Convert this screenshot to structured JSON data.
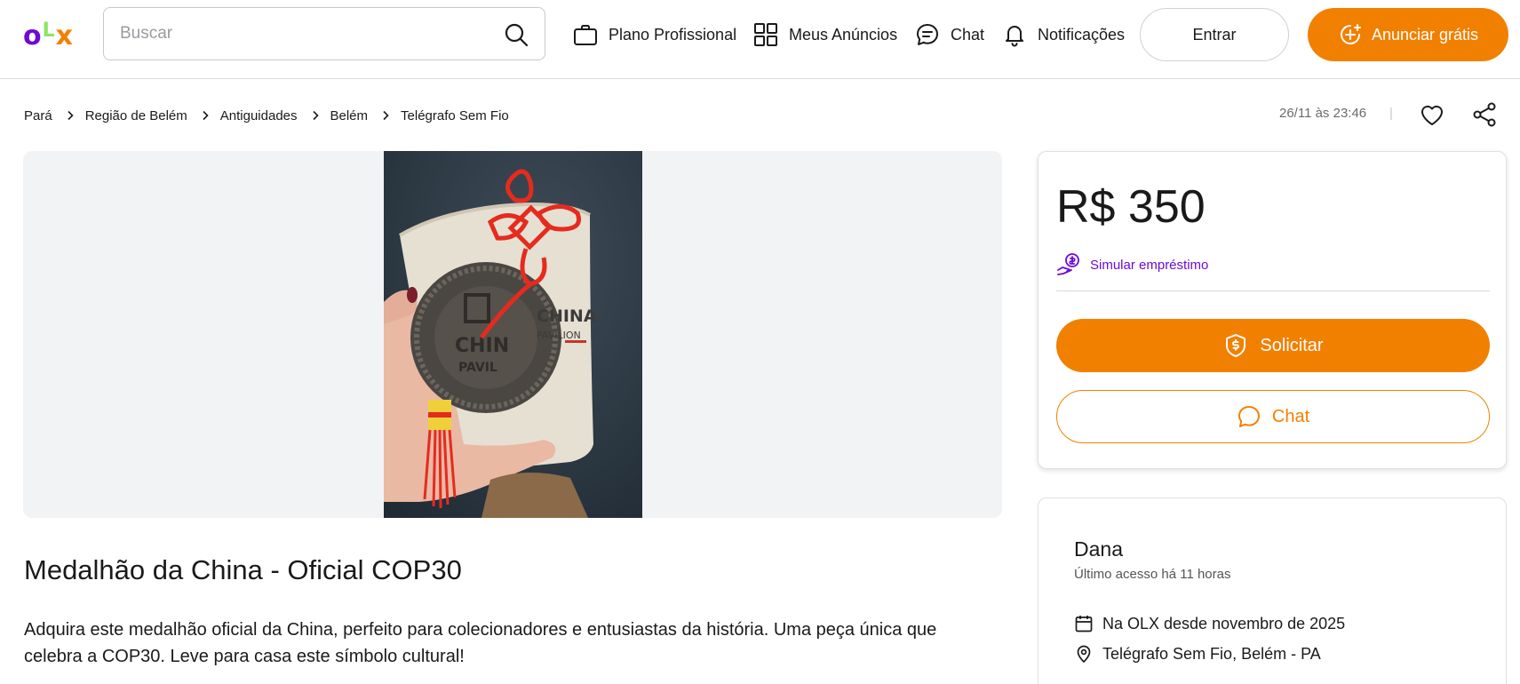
{
  "header": {
    "logo": {
      "o": "o",
      "l": "L",
      "x": "x"
    },
    "search": {
      "placeholder": "Buscar",
      "value": ""
    },
    "nav": {
      "plano": "Plano Profissional",
      "anuncios": "Meus Anúncios",
      "chat": "Chat",
      "notificacoes": "Notificações"
    },
    "entrar": "Entrar",
    "anunciar": "Anunciar grátis"
  },
  "breadcrumb": [
    "Pará",
    "Região de Belém",
    "Antiguidades",
    "Belém",
    "Telégrafo Sem Fio"
  ],
  "posted": {
    "date": "26/11 às 23:46",
    "separator": "|"
  },
  "listing": {
    "title": "Medalhão da China - Oficial COP30",
    "description": "Adquira este medalhão oficial da China, perfeito para colecionadores e entusiastas da história. Uma peça única que celebra a COP30. Leve para casa este símbolo cultural!",
    "photo_text": {
      "brand": "CHINA",
      "sub": "PAVILION"
    }
  },
  "price_card": {
    "price": "R$ 350",
    "loan_label": "Simular empréstimo",
    "solicitar": "Solicitar",
    "chat": "Chat"
  },
  "seller": {
    "name": "Dana",
    "last_access": "Último acesso há 11 horas",
    "since": "Na OLX desde novembro de 2025",
    "location": "Telégrafo Sem Fio, Belém - PA"
  },
  "colors": {
    "brand_purple": "#6e0ad6",
    "brand_orange": "#f28000",
    "brand_green": "#8ce563"
  }
}
